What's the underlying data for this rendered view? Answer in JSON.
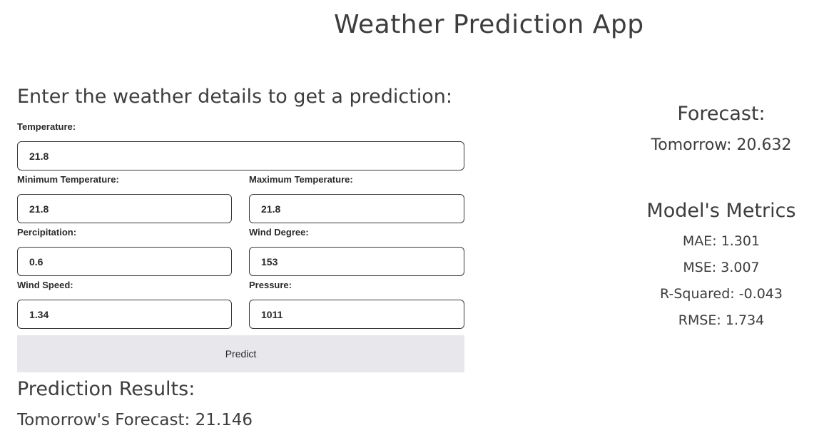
{
  "app": {
    "title": "Weather Prediction App"
  },
  "form": {
    "heading": "Enter the weather details to get a prediction:",
    "fields": {
      "temperature": {
        "label": "Temperature:",
        "value": "21.8"
      },
      "min_temperature": {
        "label": "Minimum Temperature:",
        "value": "21.8"
      },
      "max_temperature": {
        "label": "Maximum Temperature:",
        "value": "21.8"
      },
      "precipitation": {
        "label": "Percipitation:",
        "value": "0.6"
      },
      "wind_degree": {
        "label": "Wind Degree:",
        "value": "153"
      },
      "wind_speed": {
        "label": "Wind Speed:",
        "value": "1.34"
      },
      "pressure": {
        "label": "Pressure:",
        "value": "1011"
      }
    },
    "predict_label": "Predict"
  },
  "results": {
    "heading": "Prediction Results:",
    "tomorrow_forecast": "Tomorrow's Forecast: 21.146"
  },
  "forecast": {
    "heading": "Forecast:",
    "tomorrow": "Tomorrow: 20.632"
  },
  "metrics": {
    "heading": "Model's Metrics",
    "mae": "MAE: 1.301",
    "mse": "MSE: 3.007",
    "r_squared": "R-Squared: -0.043",
    "rmse": "RMSE: 1.734"
  }
}
